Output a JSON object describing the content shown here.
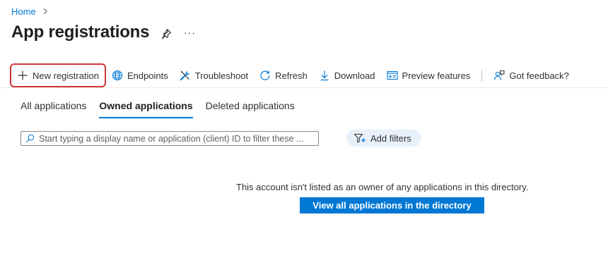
{
  "breadcrumb": {
    "home": "Home"
  },
  "header": {
    "title": "App registrations",
    "more": "···"
  },
  "toolbar": {
    "new_registration": "New registration",
    "endpoints": "Endpoints",
    "troubleshoot": "Troubleshoot",
    "refresh": "Refresh",
    "download": "Download",
    "preview_features": "Preview features",
    "feedback": "Got feedback?"
  },
  "tabs": [
    {
      "label": "All applications",
      "active": false
    },
    {
      "label": "Owned applications",
      "active": true
    },
    {
      "label": "Deleted applications",
      "active": false
    }
  ],
  "search": {
    "placeholder": "Start typing a display name or application (client) ID to filter these ..."
  },
  "filters": {
    "label": "Add filters"
  },
  "empty_state": {
    "message": "This account isn't listed as an owner of any applications in this directory.",
    "button": "View all applications in the directory"
  },
  "colors": {
    "accent": "#0078d4",
    "highlight": "#d13438",
    "filter_bg": "#e8f1f9"
  }
}
